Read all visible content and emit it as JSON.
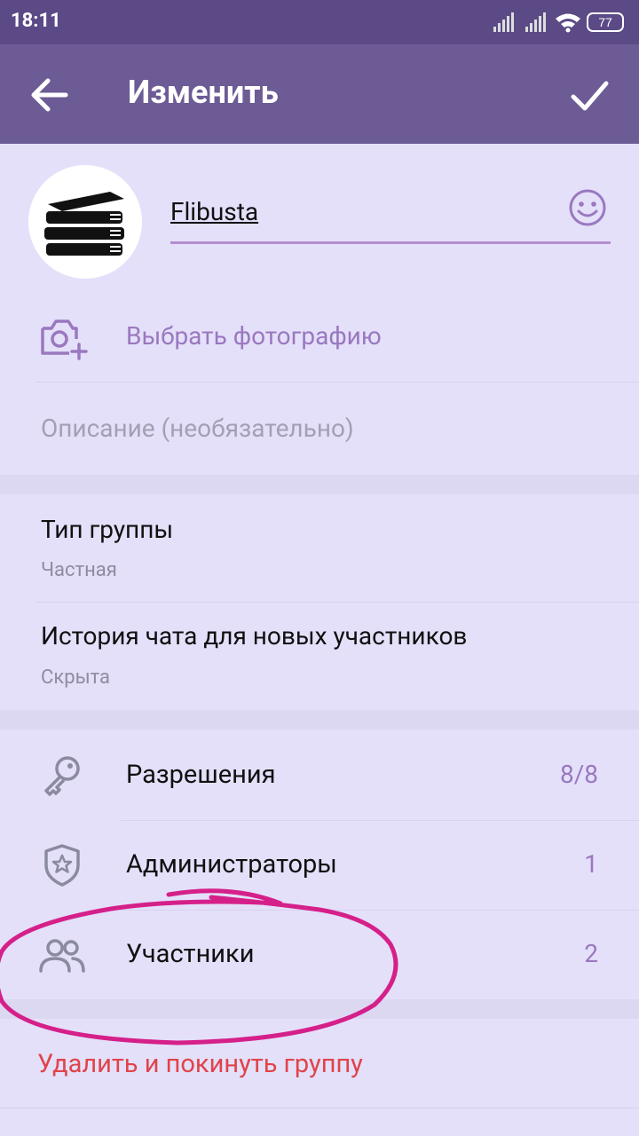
{
  "status_bar": {
    "time": "18:11",
    "battery": "77"
  },
  "app_bar": {
    "title": "Изменить"
  },
  "group": {
    "name": "Flibusta"
  },
  "photo": {
    "choose_label": "Выбрать фотографию"
  },
  "description": {
    "placeholder": "Описание (необязательно)"
  },
  "settings": {
    "group_type": {
      "title": "Тип группы",
      "value": "Частная"
    },
    "history": {
      "title": "История чата для новых участников",
      "value": "Скрыта"
    }
  },
  "actions": [
    {
      "label": "Разрешения",
      "count": "8/8",
      "icon": "key-icon"
    },
    {
      "label": "Администраторы",
      "count": "1",
      "icon": "shield-star-icon"
    },
    {
      "label": "Участники",
      "count": "2",
      "icon": "users-icon"
    }
  ],
  "delete": {
    "label": "Удалить и покинуть группу"
  },
  "colors": {
    "accent": "#6c5b95",
    "danger": "#e0444a",
    "highlight": "#d5208a"
  }
}
